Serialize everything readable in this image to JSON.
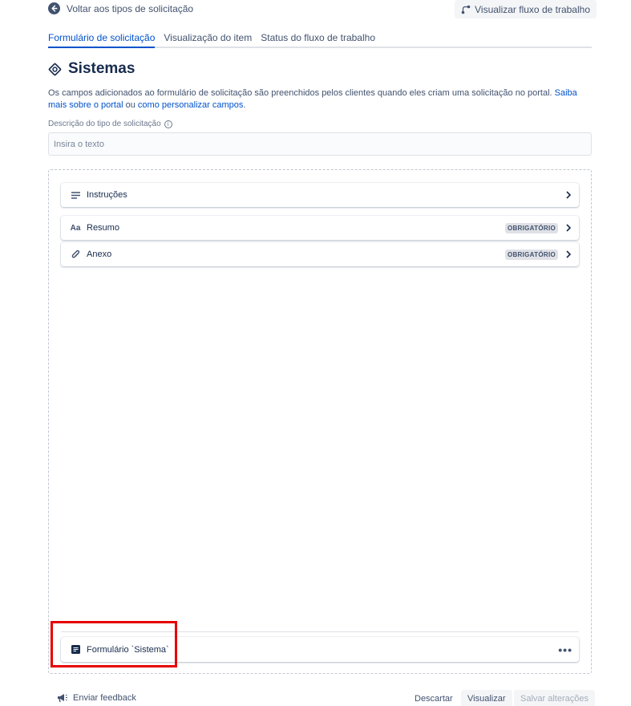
{
  "header": {
    "back_label": "Voltar aos tipos de solicitação",
    "workflow_button_label": "Visualizar fluxo de trabalho"
  },
  "tabs": [
    {
      "label": "Formulário de solicitação",
      "active": true
    },
    {
      "label": "Visualização do item",
      "active": false
    },
    {
      "label": "Status do fluxo de trabalho",
      "active": false
    }
  ],
  "page": {
    "title": "Sistemas",
    "icon": "lifebuoy-icon",
    "intro_text": "Os campos adicionados ao formulário de solicitação são preenchidos pelos clientes quando eles criam uma solicitação no portal.",
    "intro_link1": "Saiba mais sobre o portal",
    "intro_or": "ou",
    "intro_link2": "como personalizar campos",
    "intro_end": "."
  },
  "description": {
    "label": "Descrição do tipo de solicitação",
    "placeholder": "Insira o texto"
  },
  "fields": [
    {
      "label": "Instruções",
      "icon": "text-lines-icon",
      "badge": ""
    },
    {
      "label": "Resumo",
      "icon": "text-format-icon",
      "icon_text": "Aa",
      "badge": "OBRIGATÓRIO"
    },
    {
      "label": "Anexo",
      "icon": "paperclip-icon",
      "badge": "OBRIGATÓRIO"
    }
  ],
  "form_item": {
    "label": "Formulário `Sistema`",
    "icon": "form-icon",
    "more_label": "•••"
  },
  "footer": {
    "feedback_label": "Enviar feedback",
    "discard_label": "Descartar",
    "preview_label": "Visualizar",
    "save_label": "Salvar alterações"
  },
  "colors": {
    "accent": "#0052cc",
    "highlight": "#e60000"
  }
}
